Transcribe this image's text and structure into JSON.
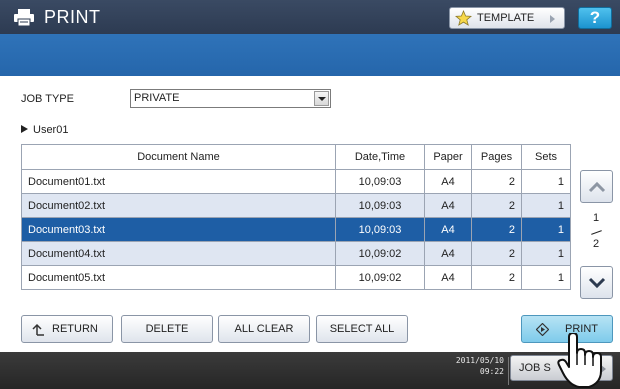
{
  "header": {
    "title": "PRINT",
    "template_label": "TEMPLATE",
    "help_label": "?"
  },
  "job_type": {
    "label": "JOB TYPE",
    "selected": "PRIVATE"
  },
  "user": "User01",
  "table": {
    "columns": [
      "Document Name",
      "Date,Time",
      "Paper",
      "Pages",
      "Sets"
    ],
    "rows": [
      {
        "name": "Document01.txt",
        "datetime": "10,09:03",
        "paper": "A4",
        "pages": "2",
        "sets": "1"
      },
      {
        "name": "Document02.txt",
        "datetime": "10,09:03",
        "paper": "A4",
        "pages": "2",
        "sets": "1"
      },
      {
        "name": "Document03.txt",
        "datetime": "10,09:03",
        "paper": "A4",
        "pages": "2",
        "sets": "1"
      },
      {
        "name": "Document04.txt",
        "datetime": "10,09:02",
        "paper": "A4",
        "pages": "2",
        "sets": "1"
      },
      {
        "name": "Document05.txt",
        "datetime": "10,09:02",
        "paper": "A4",
        "pages": "2",
        "sets": "1"
      }
    ],
    "selected_row_index": 2
  },
  "pagination": {
    "current": "1",
    "total": "2"
  },
  "buttons": {
    "return": "RETURN",
    "delete": "DELETE",
    "all_clear": "ALL CLEAR",
    "select_all": "SELECT ALL",
    "print": "PRINT"
  },
  "status": {
    "date": "2011/05/10",
    "time": "09:22",
    "job_status_label": "JOB S"
  },
  "colors": {
    "header_bg": "#2d3b52",
    "band_blue": "#2566ab",
    "selected_row": "#1e5ea5",
    "alt_row": "#dfe6f2",
    "print_button": "#7ecbeb",
    "help_button": "#1c93cf"
  },
  "icons": {
    "header": "printer-icon",
    "template": "star-icon",
    "return": "return-arrow-icon",
    "print": "diamond-start-icon",
    "scroll_up": "chevron-up-icon",
    "scroll_down": "chevron-down-icon",
    "cursor": "hand-pointer-icon"
  }
}
